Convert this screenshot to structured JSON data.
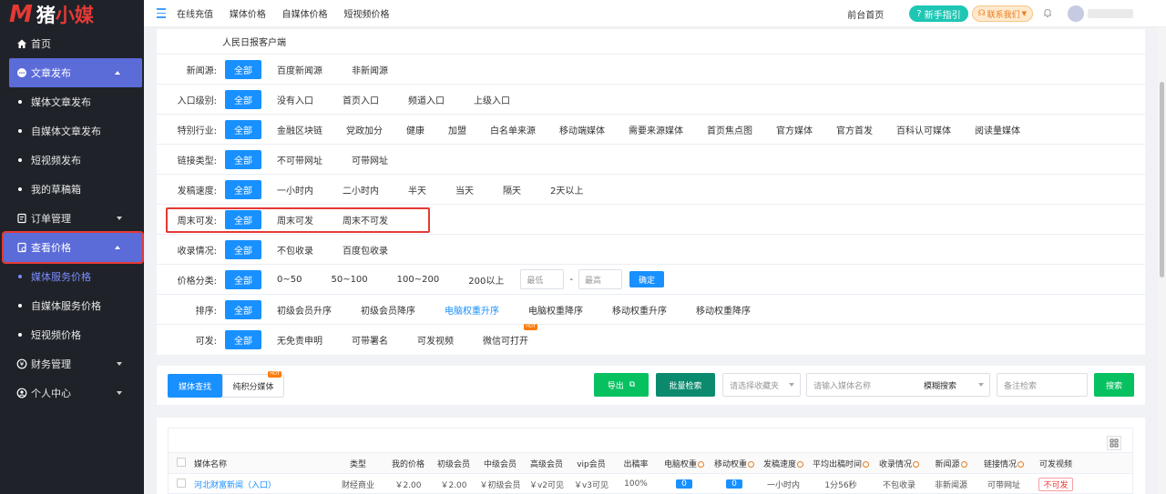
{
  "app": {
    "logo_mark": "M",
    "logo_text_a": "猪",
    "logo_text_b": "小",
    "logo_text_c": "媒"
  },
  "sidebar": {
    "items": [
      {
        "label": "首页",
        "icon": "home-icon"
      },
      {
        "label": "文章发布",
        "icon": "chat-icon",
        "expanded": true
      },
      {
        "label": "媒体文章发布"
      },
      {
        "label": "自媒体文章发布"
      },
      {
        "label": "短视频发布"
      },
      {
        "label": "我的草稿箱"
      },
      {
        "label": "订单管理",
        "icon": "order-icon"
      },
      {
        "label": "查看价格",
        "icon": "price-icon",
        "expanded": true
      },
      {
        "label": "媒体服务价格",
        "current": true
      },
      {
        "label": "自媒体服务价格"
      },
      {
        "label": "短视频价格"
      },
      {
        "label": "财务管理",
        "icon": "finance-icon"
      },
      {
        "label": "个人中心",
        "icon": "user-icon"
      }
    ]
  },
  "header": {
    "nav": [
      "在线充值",
      "媒体价格",
      "自媒体价格",
      "短视频价格"
    ],
    "front_label": "前台首页",
    "guide_label": "新手指引",
    "contact_label": "联系我们"
  },
  "filters": {
    "top_item": "人民日报客户端",
    "all_label": "全部",
    "rows": [
      {
        "label": "新闻源:",
        "options": [
          "百度新闻源",
          "非新闻源"
        ]
      },
      {
        "label": "入口级别:",
        "options": [
          "没有入口",
          "首页入口",
          "频道入口",
          "上级入口"
        ]
      },
      {
        "label": "特别行业:",
        "options": [
          "金融区块链",
          "党政加分",
          "健康",
          "加盟",
          "白名单来源",
          "移动端媒体",
          "需要来源媒体",
          "首页焦点图",
          "官方媒体",
          "官方首发",
          "百科认可媒体",
          "阅读量媒体"
        ]
      },
      {
        "label": "链接类型:",
        "options": [
          "不可带网址",
          "可带网址"
        ]
      },
      {
        "label": "发稿速度:",
        "options": [
          "一小时内",
          "二小时内",
          "半天",
          "当天",
          "隔天",
          "2天以上"
        ]
      },
      {
        "label": "周末可发:",
        "options": [
          "周末可发",
          "周末不可发"
        ]
      },
      {
        "label": "收录情况:",
        "options": [
          "不包收录",
          "百度包收录"
        ]
      },
      {
        "label": "价格分类:",
        "options": [
          "0~50",
          "50~100",
          "100~200",
          "200以上"
        ]
      },
      {
        "label": "排序:",
        "options": [
          "初级会员升序",
          "初级会员降序",
          "电脑权重升序",
          "电脑权重降序",
          "移动权重升序",
          "移动权重降序"
        ]
      },
      {
        "label": "可发:",
        "options": [
          "无免责申明",
          "可带署名",
          "可发视频",
          "微信可打开"
        ]
      }
    ],
    "price_min_placeholder": "最低",
    "price_sep": "-",
    "price_max_placeholder": "最高",
    "confirm_label": "确定",
    "hot_badge": "HOT"
  },
  "toolbar": {
    "tab_media": "媒体查找",
    "tab_points": "纯积分媒体",
    "hot_badge": "HOT",
    "export_label": "导出",
    "batch_label": "批量检索",
    "favorites_placeholder": "请选择收藏夹",
    "name_placeholder": "请输入媒体名称",
    "fuzzy_label": "模糊搜索",
    "remark_placeholder": "备注检索",
    "search_label": "搜索"
  },
  "table": {
    "headers": [
      "媒体名称",
      "类型",
      "我的价格",
      "初级会员",
      "中级会员",
      "高级会员",
      "vip会员",
      "出稿率",
      "电脑权重",
      "移动权重",
      "发稿速度",
      "平均出稿时间",
      "收录情况",
      "新闻源",
      "链接情况",
      "可发视频"
    ],
    "row": [
      "河北财富新闻（入口）",
      "财经商业",
      "￥2.00",
      "￥2.00",
      "￥初级会员",
      "￥v2可见",
      "￥v3可见",
      "100%",
      "0",
      "0",
      "一小时内",
      "1分56秒",
      "不包收录",
      "非新闻源",
      "可带网址",
      "不可发"
    ]
  },
  "colors": {
    "primary": "#1890ff",
    "green": "#07c160",
    "teal": "#1ec7b4",
    "sidebar_bg": "#1f2329",
    "highlight": "#e53935"
  }
}
